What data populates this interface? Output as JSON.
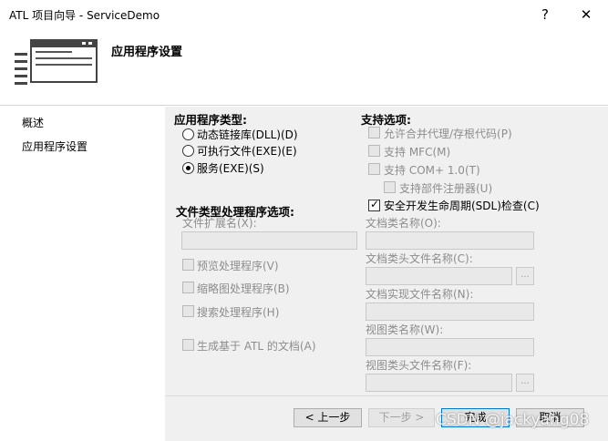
{
  "window": {
    "title": "ATL 项目向导 - ServiceDemo",
    "help_glyph": "?",
    "close_glyph": "✕"
  },
  "header": {
    "title": "应用程序设置"
  },
  "sidebar": {
    "items": [
      {
        "label": "概述"
      },
      {
        "label": "应用程序设置"
      }
    ]
  },
  "app_type": {
    "label": "应用程序类型:",
    "options": [
      {
        "label": "动态链接库(DLL)(D)",
        "checked": false
      },
      {
        "label": "可执行文件(EXE)(E)",
        "checked": false
      },
      {
        "label": "服务(EXE)(S)",
        "checked": true
      }
    ]
  },
  "support": {
    "label": "支持选项:",
    "options": [
      {
        "label": "允许合并代理/存根代码(P)",
        "enabled": false
      },
      {
        "label": "支持 MFC(M)",
        "enabled": false
      },
      {
        "label": "支持 COM+ 1.0(T)",
        "enabled": false
      },
      {
        "label": "支持部件注册器(U)",
        "enabled": false
      },
      {
        "label": "安全开发生命周期(SDL)检查(C)",
        "enabled": true,
        "checked": true
      }
    ]
  },
  "file_handler": {
    "label": "文件类型处理程序选项:",
    "ext_label": "文件扩展名(X):",
    "preview_label": "预览处理程序(V)",
    "thumb_label": "缩略图处理程序(B)",
    "search_label": "搜索处理程序(H)",
    "atl_doc_label": "生成基于 ATL 的文档(A)"
  },
  "doc_fields": {
    "doc_class": "文档类名称(O):",
    "doc_header": "文档类头文件名称(C):",
    "doc_impl": "文档实现文件名称(N):",
    "view_class": "视图类名称(W):",
    "view_header": "视图类头文件名称(F):",
    "browse": "..."
  },
  "buttons": {
    "back": "< 上一步",
    "next": "下一步 >",
    "finish": "完成",
    "cancel": "取消"
  },
  "watermark": "CSDN @jackyang08"
}
